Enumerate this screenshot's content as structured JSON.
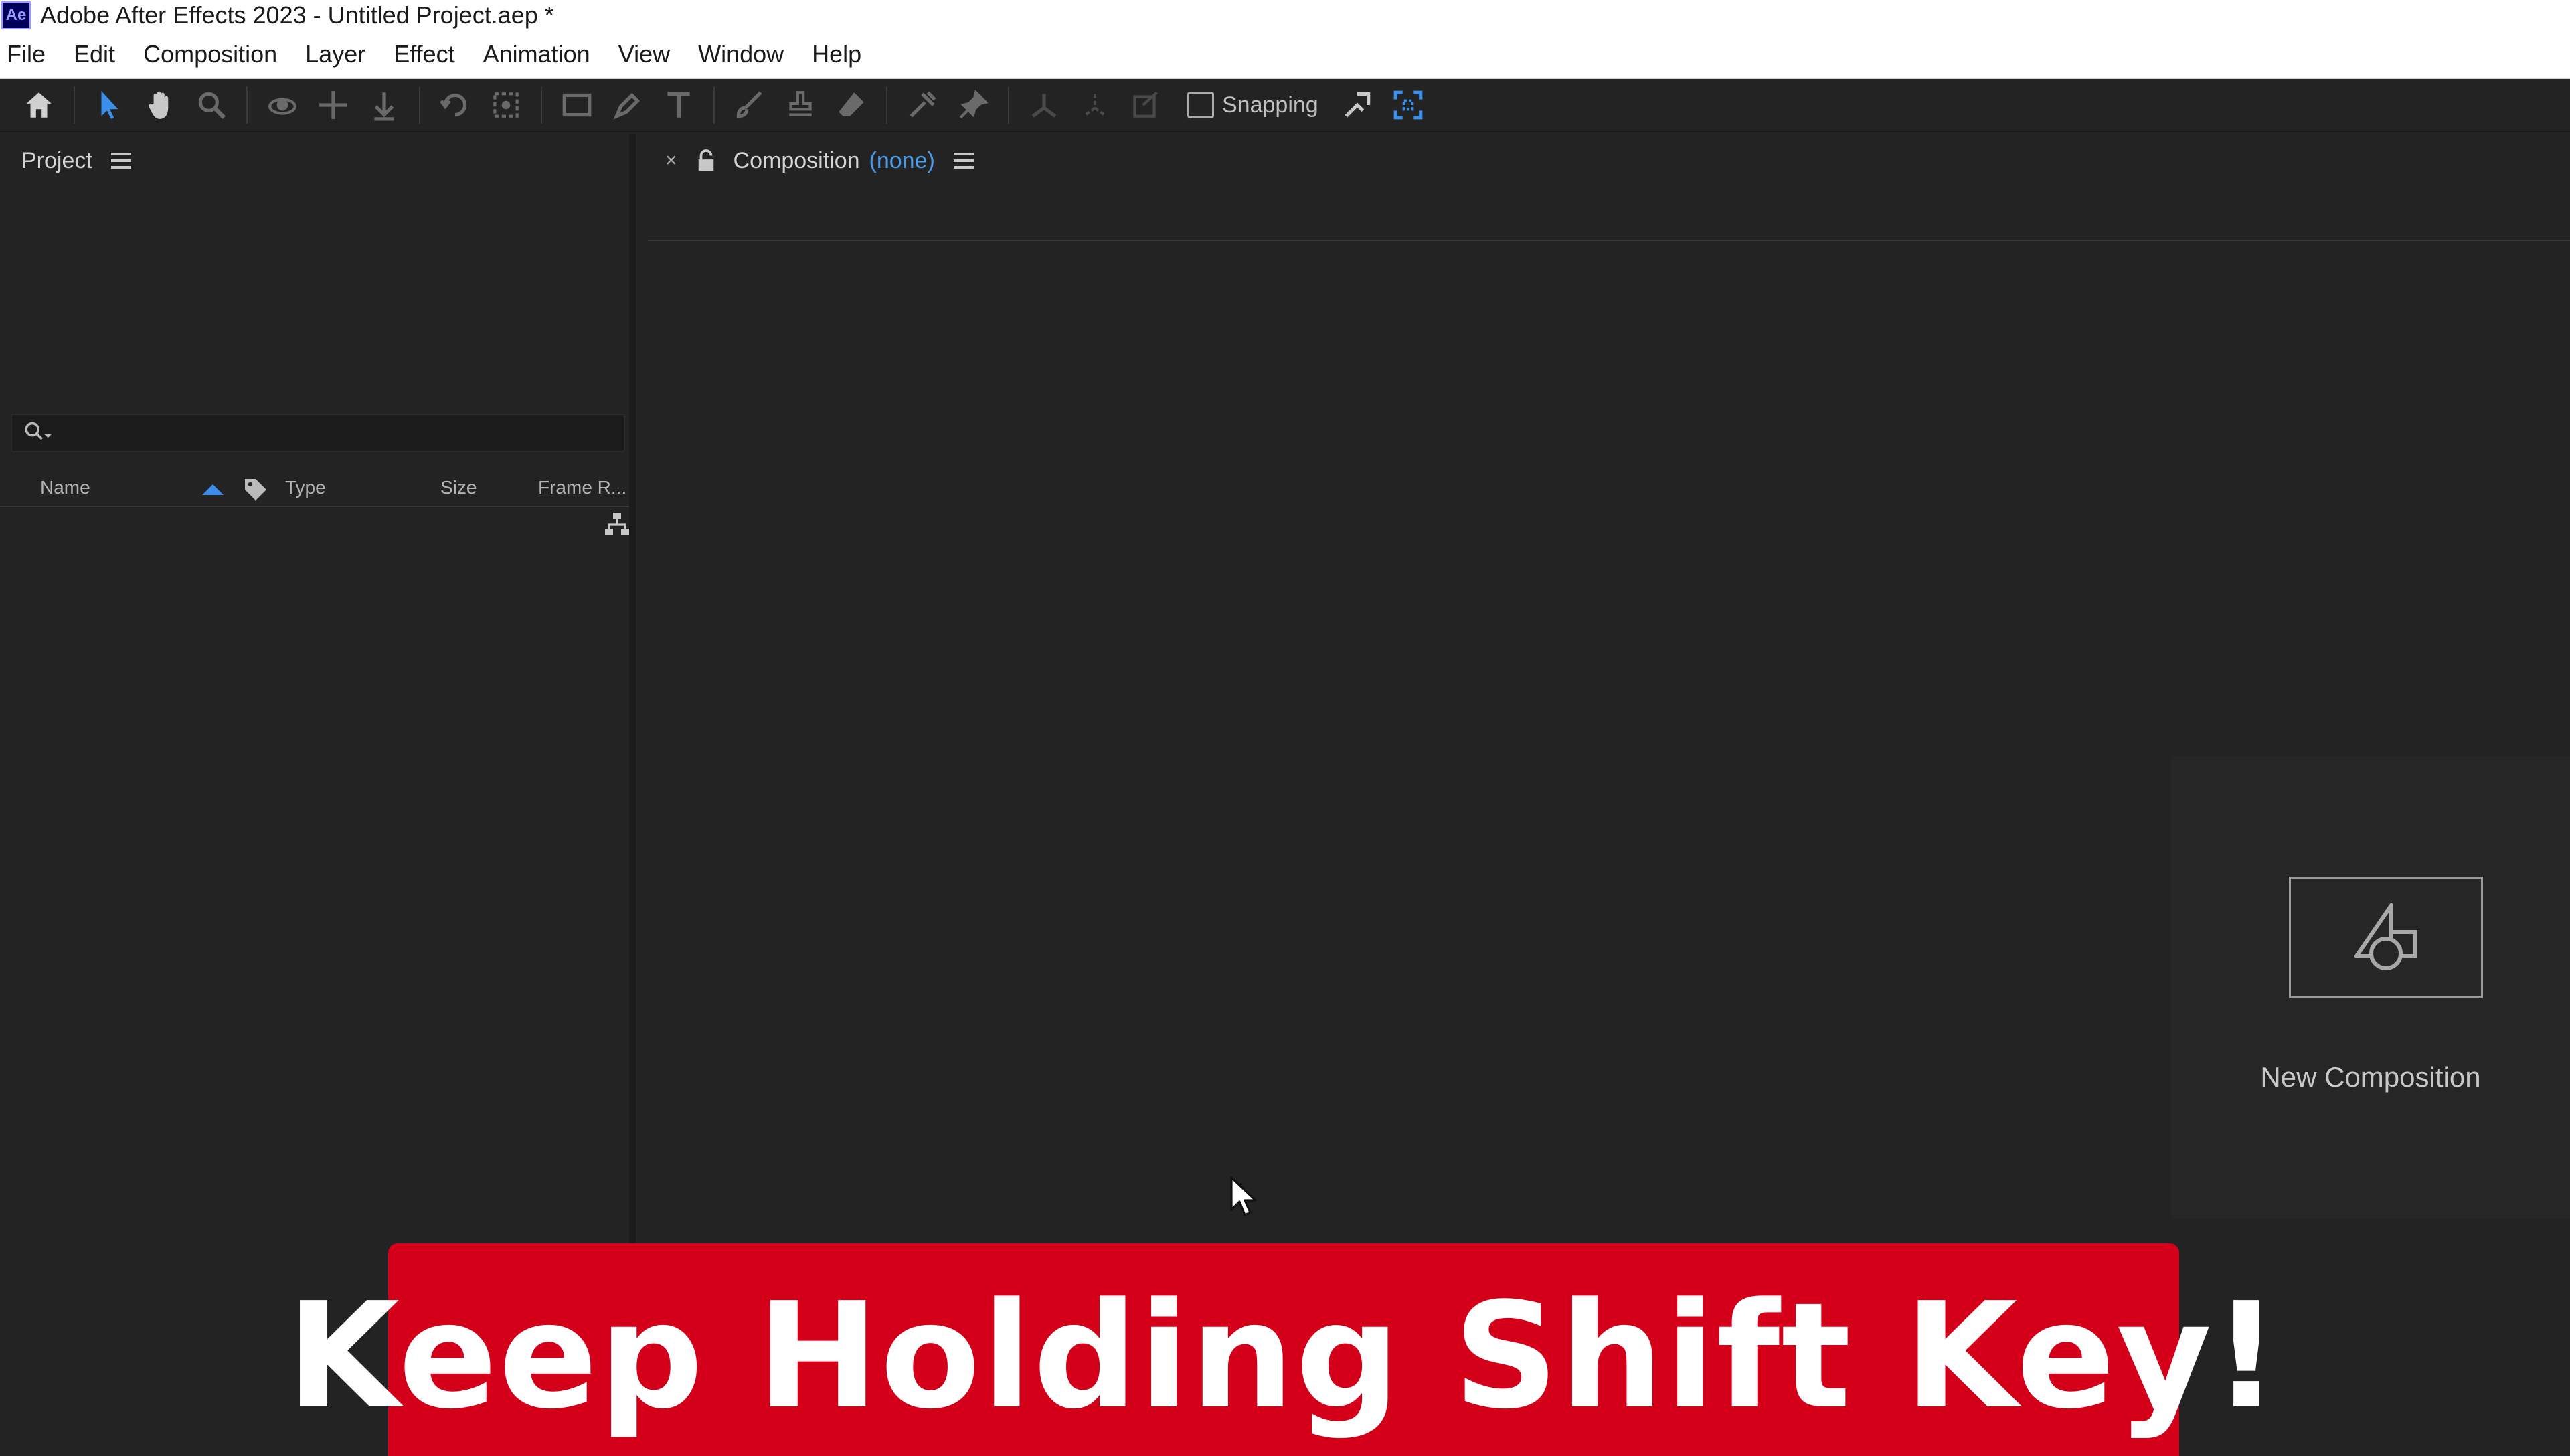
{
  "app": {
    "logo_text": "Ae",
    "window_title": "Adobe After Effects 2023 - Untitled Project.aep *"
  },
  "menu": [
    "File",
    "Edit",
    "Composition",
    "Layer",
    "Effect",
    "Animation",
    "View",
    "Window",
    "Help"
  ],
  "toolbar": {
    "snapping_label": "Snapping"
  },
  "project_panel": {
    "title": "Project",
    "search_placeholder": "",
    "columns": {
      "name": "Name",
      "type": "Type",
      "size": "Size",
      "frame_rate": "Frame R..."
    }
  },
  "composition_panel": {
    "close_label": "×",
    "title": "Composition",
    "active": "(none)",
    "new_composition_label": "New Composition"
  },
  "banner": {
    "text": "Keep Holding Shift Key!",
    "color": "#d4001a"
  },
  "colors": {
    "accent": "#4b9be8",
    "panel_bg": "#232323",
    "titlebar_bg": "#ffffff"
  }
}
